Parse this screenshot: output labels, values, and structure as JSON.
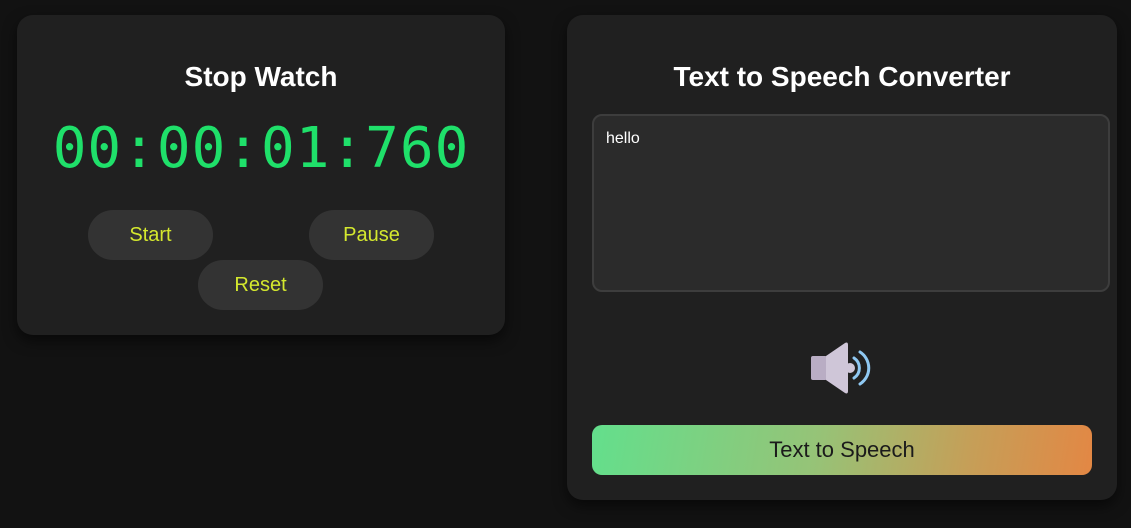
{
  "stopwatch": {
    "title": "Stop Watch",
    "time": "00:00:01:760",
    "buttons": {
      "start": "Start",
      "pause": "Pause",
      "reset": "Reset"
    },
    "colors": {
      "time": "#1fe06a",
      "button_text": "#d4e82e"
    }
  },
  "tts": {
    "title": "Text to Speech Converter",
    "text_value": "hello",
    "icon": "speaker-icon",
    "button_label": "Text to Speech",
    "colors": {
      "gradient_start": "#63df8c",
      "gradient_end": "#e38744"
    }
  }
}
